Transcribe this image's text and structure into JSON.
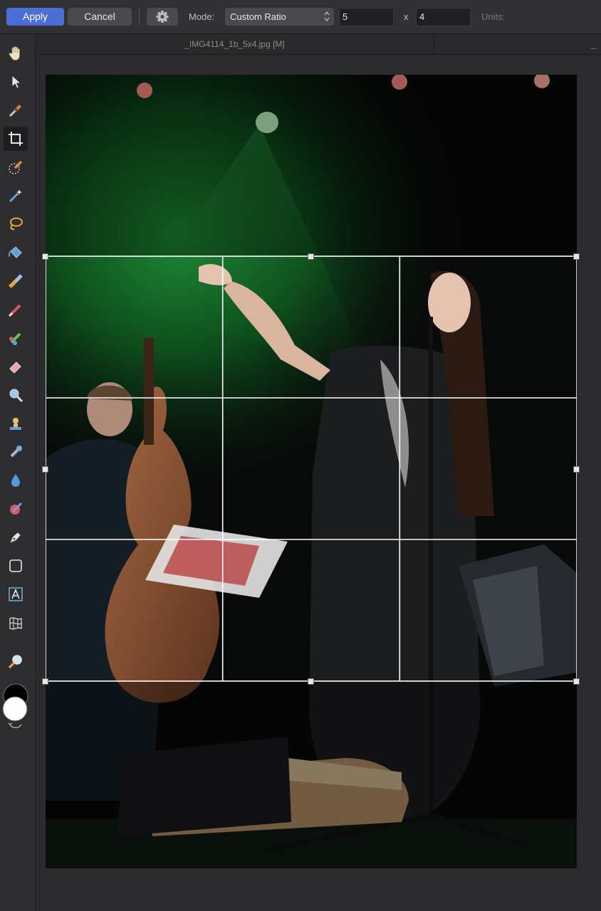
{
  "toolbar": {
    "apply_label": "Apply",
    "cancel_label": "Cancel",
    "mode_label": "Mode:",
    "mode_value": "Custom Ratio",
    "ratio_width": "5",
    "ratio_separator": "x",
    "ratio_height": "4",
    "units_label": "Units:"
  },
  "document": {
    "tab_title": "_IMG4114_1b_5x4.jpg [M]",
    "tab2_title": "_"
  },
  "tools": [
    {
      "name": "hand-tool",
      "icon": "hand-icon"
    },
    {
      "name": "move-tool",
      "icon": "pointer-icon"
    },
    {
      "name": "color-picker-tool",
      "icon": "eyedropper-icon"
    },
    {
      "name": "crop-tool",
      "icon": "crop-icon",
      "active": true
    },
    {
      "name": "selection-brush-tool",
      "icon": "selection-brush-icon"
    },
    {
      "name": "flood-select-tool",
      "icon": "magic-wand-icon"
    },
    {
      "name": "freehand-selection-tool",
      "icon": "lasso-icon"
    },
    {
      "name": "flood-fill-tool",
      "icon": "paint-bucket-icon"
    },
    {
      "name": "gradient-tool",
      "icon": "gradient-icon"
    },
    {
      "name": "paint-brush-tool",
      "icon": "brush-icon"
    },
    {
      "name": "color-replacement-tool",
      "icon": "color-replace-icon"
    },
    {
      "name": "erase-brush-tool",
      "icon": "eraser-icon"
    },
    {
      "name": "dodge-tool",
      "icon": "dodge-icon"
    },
    {
      "name": "clone-brush-tool",
      "icon": "stamp-icon"
    },
    {
      "name": "blemish-removal-tool",
      "icon": "patch-icon"
    },
    {
      "name": "blur-brush-tool",
      "icon": "droplet-icon"
    },
    {
      "name": "red-eye-tool",
      "icon": "red-eye-icon"
    },
    {
      "name": "pen-tool",
      "icon": "pen-icon"
    },
    {
      "name": "rectangle-tool",
      "icon": "rectangle-icon"
    },
    {
      "name": "artistic-text-tool",
      "icon": "text-icon"
    },
    {
      "name": "mesh-warp-tool",
      "icon": "mesh-icon"
    },
    {
      "name": "zoom-tool",
      "icon": "zoom-icon"
    }
  ],
  "colors": {
    "accent": "#4a6dd6",
    "primary_color": "#000000",
    "secondary_color": "#ffffff"
  },
  "crop": {
    "grid": "thirds"
  }
}
